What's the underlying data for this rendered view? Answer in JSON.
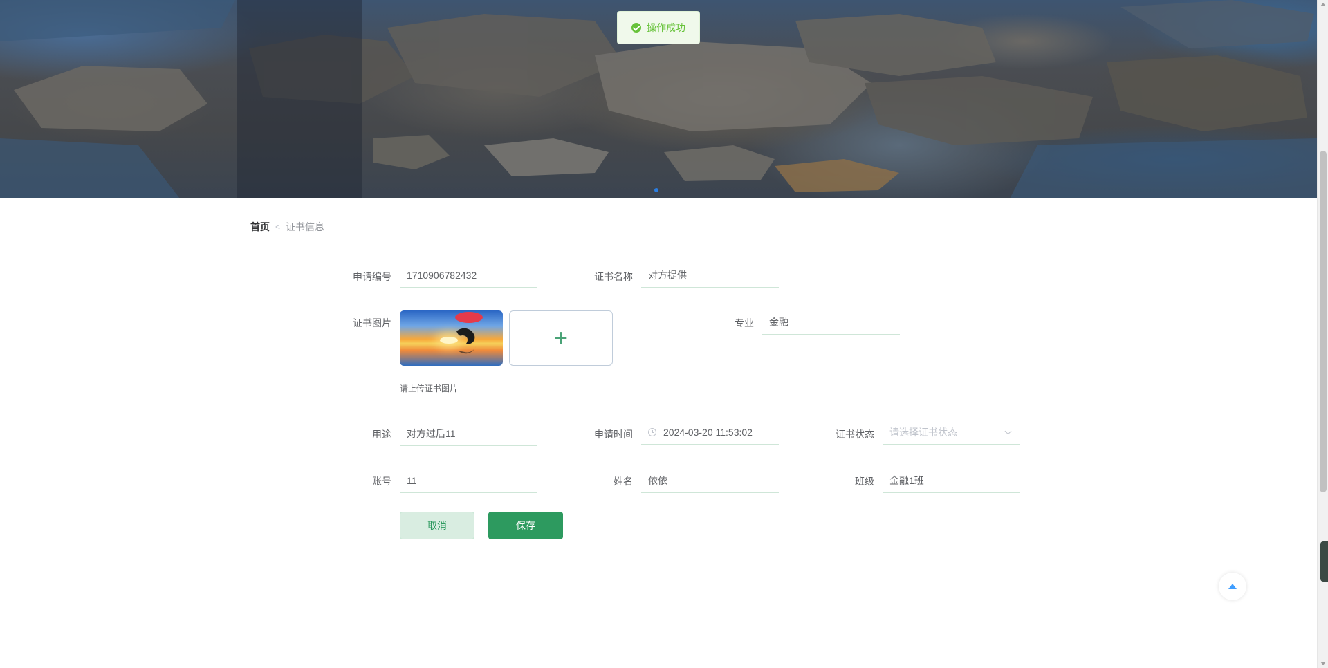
{
  "toast": {
    "message": "操作成功",
    "color": "#67c23a"
  },
  "breadcrumb": {
    "home": "首页",
    "separator": "<",
    "current": "证书信息"
  },
  "form": {
    "apply_no": {
      "label": "申请编号",
      "value": "1710906782432"
    },
    "cert_name": {
      "label": "证书名称",
      "value": "对方提供"
    },
    "cert_image": {
      "label": "证书图片",
      "tip": "请上传证书图片",
      "upload_icon": "plus-icon"
    },
    "major": {
      "label": "专业",
      "value": "金融"
    },
    "purpose": {
      "label": "用途",
      "value": "对方过后11"
    },
    "apply_time": {
      "label": "申请时间",
      "value": "2024-03-20 11:53:02"
    },
    "cert_status": {
      "label": "证书状态",
      "placeholder": "请选择证书状态"
    },
    "account": {
      "label": "账号",
      "value": "11"
    },
    "name": {
      "label": "姓名",
      "value": "依依"
    },
    "class": {
      "label": "班级",
      "value": "金融1班"
    }
  },
  "buttons": {
    "cancel": "取消",
    "save": "保存"
  },
  "colors": {
    "accent": "#2d9a5f",
    "accent_light": "#d9ede1",
    "link": "#409eff"
  }
}
